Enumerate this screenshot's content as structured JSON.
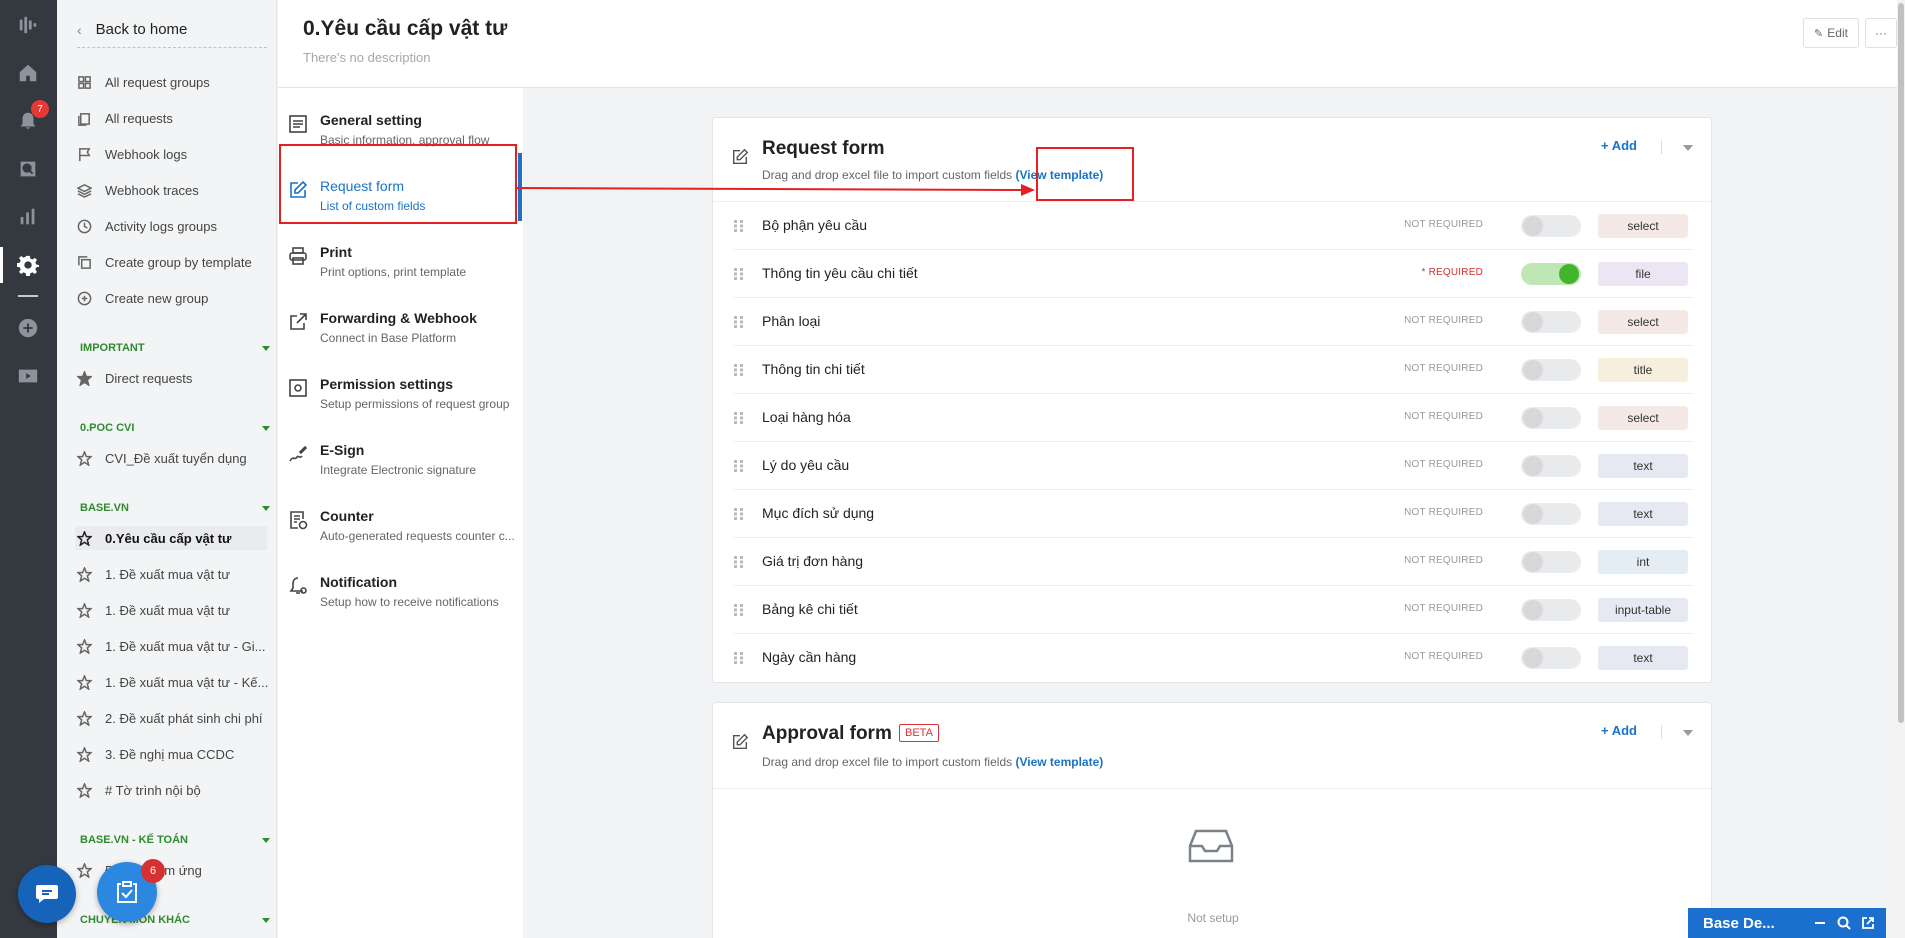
{
  "rail": {
    "notification_count": "7"
  },
  "sidebar": {
    "back_label": "Back to home",
    "nav": [
      {
        "label": "All request groups",
        "icon": "grid-icon"
      },
      {
        "label": "All requests",
        "icon": "documents-icon"
      },
      {
        "label": "Webhook logs",
        "icon": "flag-icon"
      },
      {
        "label": "Webhook traces",
        "icon": "layers-icon"
      },
      {
        "label": "Activity logs groups",
        "icon": "clock-icon"
      },
      {
        "label": "Create group by template",
        "icon": "copy-icon"
      },
      {
        "label": "Create new group",
        "icon": "plus-circle-icon"
      }
    ],
    "sections": [
      {
        "title": "IMPORTANT",
        "items": [
          "Direct requests"
        ]
      },
      {
        "title": "0.POC CVI",
        "items": [
          "CVI_Đề xuất tuyển dụng"
        ]
      },
      {
        "title": "BASE.VN",
        "items": [
          "0.Yêu cầu cấp vật tư",
          "1. Đề xuất mua vật tư",
          "1. Đề xuất mua vật tư",
          "1. Đề xuất mua vật tư - Gi...",
          "1. Đề xuất mua vật tư - Kế...",
          "2. Đề xuất phát sinh chi phí",
          "3. Đề nghị mua CCDC",
          "# Tờ trình nội bộ"
        ]
      },
      {
        "title": "BASE.VN - KẾ TOÁN",
        "items": [
          "Đề nghị tạm ứng"
        ]
      },
      {
        "title": "CHUYÊN MÔN KHÁC",
        "items": []
      }
    ]
  },
  "header": {
    "title": "0.Yêu cầu cấp vật tư",
    "description": "There's no description",
    "edit_label": "Edit",
    "more_label": "···"
  },
  "settings": [
    {
      "title": "General setting",
      "subtitle": "Basic information, approval flow"
    },
    {
      "title": "Request form",
      "subtitle": "List of custom fields"
    },
    {
      "title": "Print",
      "subtitle": "Print options, print template"
    },
    {
      "title": "Forwarding & Webhook",
      "subtitle": "Connect in Base Platform"
    },
    {
      "title": "Permission settings",
      "subtitle": "Setup permissions of request group"
    },
    {
      "title": "E-Sign",
      "subtitle": "Integrate Electronic signature"
    },
    {
      "title": "Counter",
      "subtitle": "Auto-generated requests counter c..."
    },
    {
      "title": "Notification",
      "subtitle": "Setup how to receive notifications"
    }
  ],
  "request_form": {
    "title": "Request form",
    "subtitle": "Drag and drop excel file to import custom fields",
    "template_link": "(View template)",
    "add_label": "+ Add",
    "fields": [
      {
        "name": "Bộ phận yêu cầu",
        "required_label": "NOT REQUIRED",
        "required": false,
        "type": "select",
        "type_color": "#f5e9e6"
      },
      {
        "name": "Thông tin yêu cầu chi tiết",
        "required_label": "* REQUIRED",
        "required": true,
        "type": "file",
        "type_color": "#ece6f4"
      },
      {
        "name": "Phân loại",
        "required_label": "NOT REQUIRED",
        "required": false,
        "type": "select",
        "type_color": "#f5e9e6"
      },
      {
        "name": "Thông tin chi tiết",
        "required_label": "NOT REQUIRED",
        "required": false,
        "type": "title",
        "type_color": "#f7efde"
      },
      {
        "name": "Loại hàng hóa",
        "required_label": "NOT REQUIRED",
        "required": false,
        "type": "select",
        "type_color": "#f5e9e6"
      },
      {
        "name": "Lý do yêu cầu",
        "required_label": "NOT REQUIRED",
        "required": false,
        "type": "text",
        "type_color": "#e6e9f1"
      },
      {
        "name": "Mục đích sử dụng",
        "required_label": "NOT REQUIRED",
        "required": false,
        "type": "text",
        "type_color": "#e6e9f1"
      },
      {
        "name": "Giá trị đơn hàng",
        "required_label": "NOT REQUIRED",
        "required": false,
        "type": "int",
        "type_color": "#e4ecf4"
      },
      {
        "name": "Bảng kê chi tiết",
        "required_label": "NOT REQUIRED",
        "required": false,
        "type": "input-table",
        "type_color": "#e6e9f1"
      },
      {
        "name": "Ngày cần hàng",
        "required_label": "NOT REQUIRED",
        "required": false,
        "type": "text",
        "type_color": "#e6e9f1"
      }
    ]
  },
  "approval_form": {
    "title": "Approval form",
    "beta_label": "BETA",
    "subtitle": "Drag and drop excel file to import custom fields",
    "template_link": "(View template)",
    "add_label": "+ Add",
    "empty_text": "Not setup"
  },
  "floating": {
    "task_count": "6",
    "base_widget_label": "Base De..."
  },
  "colors": {
    "accent": "#1a73c8",
    "section_green": "#2e8b2e",
    "annotation_red": "#e52020",
    "toggle_on": "#43b52d"
  }
}
